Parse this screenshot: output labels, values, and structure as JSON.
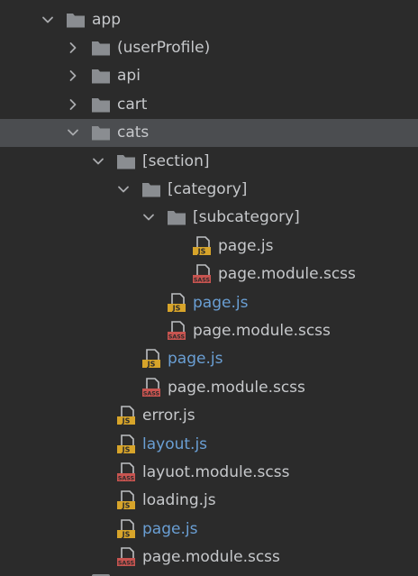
{
  "colors": {
    "background": "#2b2b2b",
    "selected_row": "#4b4d50",
    "text": "#c6c8cb",
    "vcs_modified_text": "#6a9fd4",
    "folder": "#8a8d91",
    "js_badge": "#d7a42a",
    "sass_badge": "#c75450"
  },
  "tree": {
    "items": [
      {
        "label": "app",
        "type": "folder",
        "expanded": true,
        "depth": 0
      },
      {
        "label": "(userProfile)",
        "type": "folder",
        "expanded": false,
        "depth": 1
      },
      {
        "label": "api",
        "type": "folder",
        "expanded": false,
        "depth": 1
      },
      {
        "label": "cart",
        "type": "folder",
        "expanded": false,
        "depth": 1
      },
      {
        "label": "cats",
        "type": "folder",
        "expanded": true,
        "depth": 1,
        "selected": true
      },
      {
        "label": "[section]",
        "type": "folder",
        "expanded": true,
        "depth": 2
      },
      {
        "label": "[category]",
        "type": "folder",
        "expanded": true,
        "depth": 3
      },
      {
        "label": "[subcategory]",
        "type": "folder",
        "expanded": true,
        "depth": 4
      },
      {
        "label": "page.js",
        "type": "js",
        "depth": 5
      },
      {
        "label": "page.module.scss",
        "type": "sass",
        "depth": 5
      },
      {
        "label": "page.js",
        "type": "js",
        "depth": 4,
        "modified": true
      },
      {
        "label": "page.module.scss",
        "type": "sass",
        "depth": 4
      },
      {
        "label": "page.js",
        "type": "js",
        "depth": 3,
        "modified": true
      },
      {
        "label": "page.module.scss",
        "type": "sass",
        "depth": 3
      },
      {
        "label": "error.js",
        "type": "js",
        "depth": 2
      },
      {
        "label": "layout.js",
        "type": "js",
        "depth": 2,
        "modified": true
      },
      {
        "label": "layuot.module.scss",
        "type": "sass",
        "depth": 2
      },
      {
        "label": "loading.js",
        "type": "js",
        "depth": 2
      },
      {
        "label": "page.js",
        "type": "js",
        "depth": 2,
        "modified": true
      },
      {
        "label": "page.module.scss",
        "type": "sass",
        "depth": 2
      }
    ],
    "icons": {
      "folder": "folder-icon",
      "js": "js-file-icon",
      "sass": "sass-file-icon",
      "expanded": "chevron-down-icon",
      "collapsed": "chevron-right-icon"
    }
  }
}
